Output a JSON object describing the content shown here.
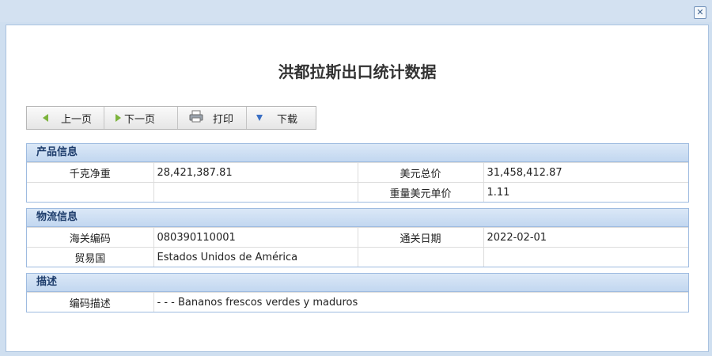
{
  "window": {
    "close_label": "✕"
  },
  "title": "洪都拉斯出口统计数据",
  "toolbar": {
    "prev": "上一页",
    "next": "下一页",
    "print": "打印",
    "download": "下载"
  },
  "product": {
    "header": "产品信息",
    "net_weight_label": "千克净重",
    "net_weight_value": "28,421,387.81",
    "usd_total_label": "美元总价",
    "usd_total_value": "31,458,412.87",
    "unit_price_label": "重量美元单价",
    "unit_price_value": "1.11"
  },
  "logistics": {
    "header": "物流信息",
    "hs_code_label": "海关编码",
    "hs_code_value": "080390110001",
    "clearance_date_label": "通关日期",
    "clearance_date_value": "2022-02-01",
    "trade_country_label": "贸易国",
    "trade_country_value": "Estados Unidos de América"
  },
  "description": {
    "header": "描述",
    "code_desc_label": "编码描述",
    "code_desc_value": "- - - Bananos frescos verdes y maduros"
  }
}
